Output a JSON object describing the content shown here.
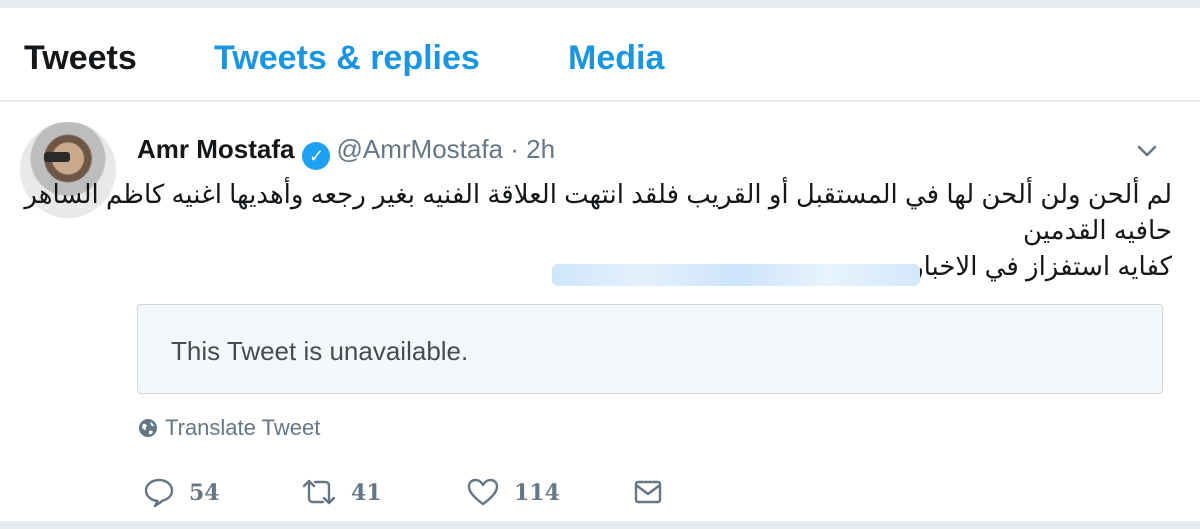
{
  "tabs": [
    {
      "label": "Tweets",
      "active": true
    },
    {
      "label": "Tweets & replies",
      "active": false
    },
    {
      "label": "Media",
      "active": false
    }
  ],
  "tweet": {
    "name": "Amr Mostafa",
    "verified_icon": "verified-badge",
    "handle": "@AmrMostafa",
    "separator": "·",
    "time": "2h",
    "lines": [
      "لم ألحن ولن ألحن لها في المستقبل أو القريب فلقد انتهت العلاقة الفنيه بغير رجعه وأهديها اغنيه كاظم الساهر",
      "حافيه القدمين",
      "كفايه استفزاز في الاخبار"
    ],
    "quoted": "This Tweet is unavailable.",
    "translate": "Translate Tweet",
    "counts": {
      "replies": "54",
      "retweets": "41",
      "likes": "114"
    }
  },
  "colors": {
    "accent": "#1b95e0",
    "verified": "#1da1f2",
    "muted": "#657786",
    "border": "#e6ecf0"
  }
}
